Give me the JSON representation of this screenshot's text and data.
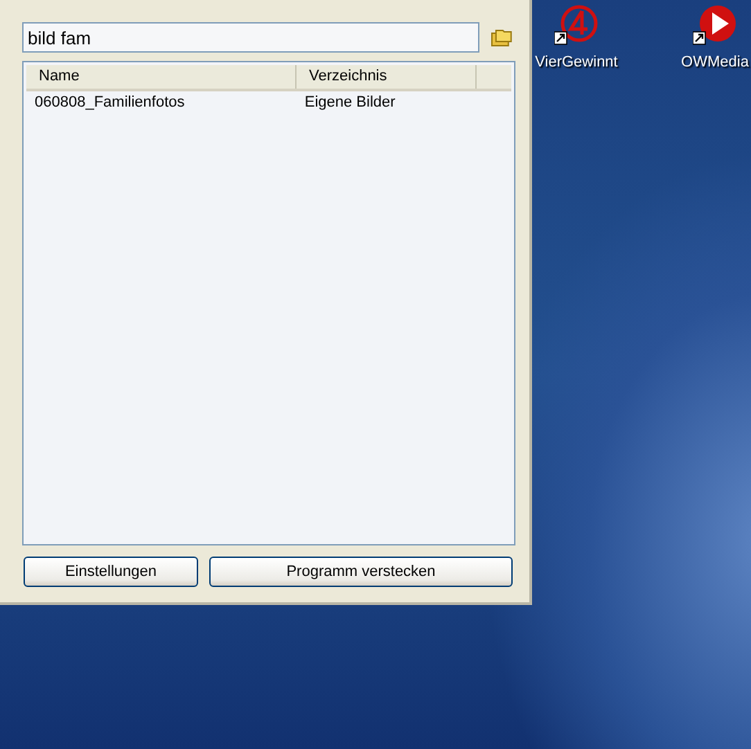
{
  "search": {
    "value": "bild fam"
  },
  "results": {
    "columns": [
      "Name",
      "Verzeichnis"
    ],
    "rows": [
      {
        "cells": [
          "060808_Familienfotos",
          "Eigene Bilder"
        ],
        "selected": false
      }
    ]
  },
  "buttons": [
    "Einstellungen",
    "Programm verstecken"
  ],
  "desktop_icons": [
    {
      "kind": "four",
      "label": "VierGewinnt"
    },
    {
      "kind": "play",
      "label": "OWMedia"
    }
  ]
}
